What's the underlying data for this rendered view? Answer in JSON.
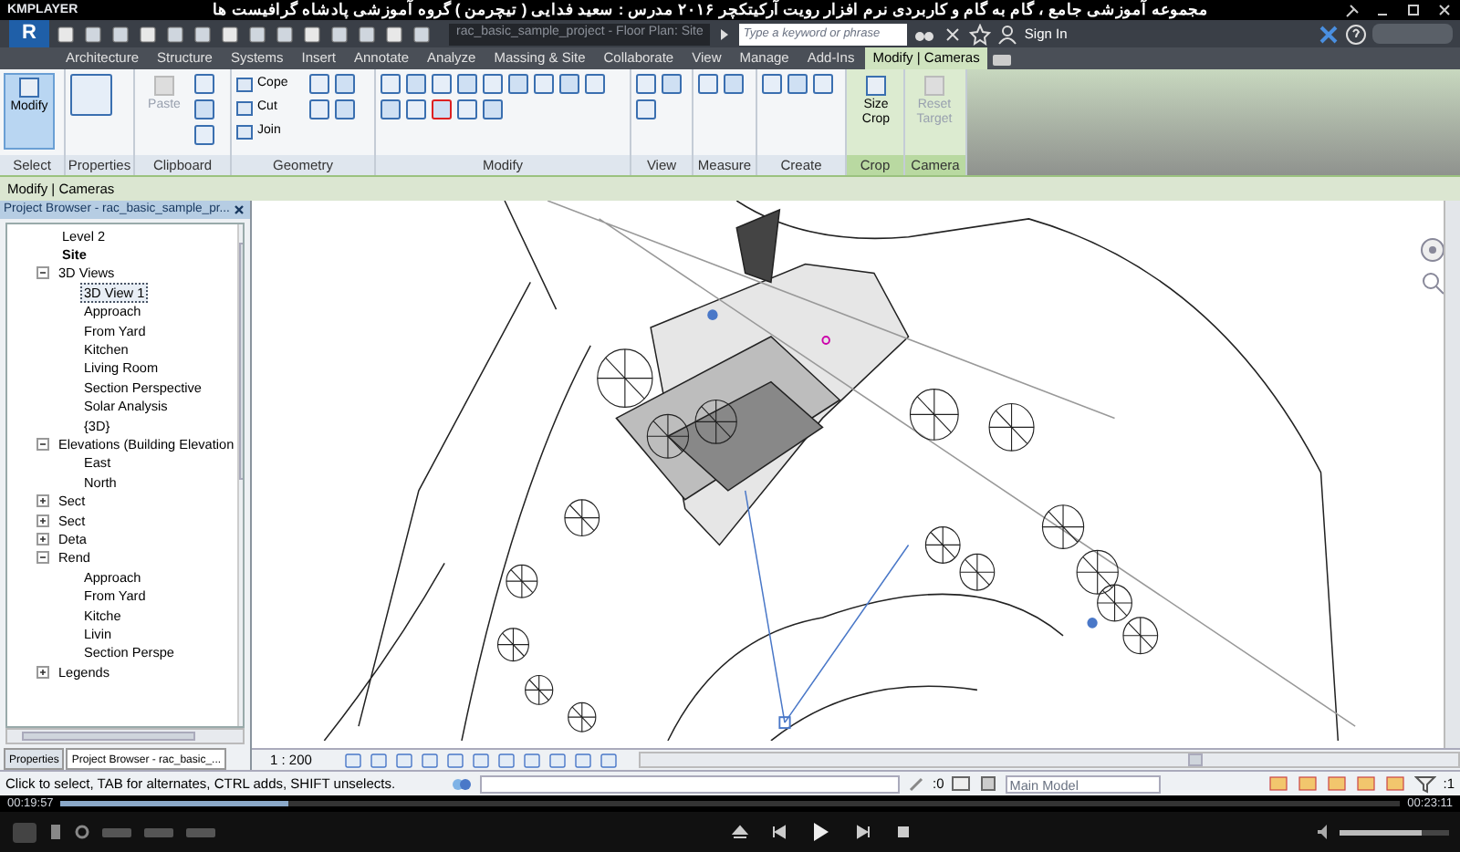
{
  "player": {
    "logo": "KMPLAYER",
    "title": "مجموعه آموزشی جامع ، گام به گام و کاربردی نرم افزار رویت آرکیتکچر ۲۰۱۶  مدرس : سعید فدایی ( تیچرمن ) گروه آموزشی پادشاه گرافیست ها",
    "elapsed": "00:19:57",
    "total": "00:23:11",
    "progress": {
      "level": 0.17
    },
    "volume": {
      "level": 0.75
    }
  },
  "app": {
    "logo": "R",
    "file_tab": "rac_basic_sample_project - Floor Plan: Site",
    "search": {
      "placeholder": "Type a keyword or phrase"
    },
    "sign_in": "Sign In"
  },
  "ribbon_tabs": [
    {
      "label": "Architecture",
      "selected": false
    },
    {
      "label": "Structure",
      "selected": false
    },
    {
      "label": "Systems",
      "selected": false
    },
    {
      "label": "Insert",
      "selected": false
    },
    {
      "label": "Annotate",
      "selected": false
    },
    {
      "label": "Analyze",
      "selected": false
    },
    {
      "label": "Massing & Site",
      "selected": false
    },
    {
      "label": "Collaborate",
      "selected": false
    },
    {
      "label": "View",
      "selected": false
    },
    {
      "label": "Manage",
      "selected": false
    },
    {
      "label": "Add-Ins",
      "selected": false
    },
    {
      "label": "Modify | Cameras",
      "selected": true
    }
  ],
  "panels": [
    {
      "label": "Select",
      "contextual": false,
      "tools": [
        {
          "label": "Modify",
          "selected": true,
          "disabled": false
        }
      ]
    },
    {
      "label": "Properties",
      "contextual": false
    },
    {
      "label": "Clipboard",
      "contextual": false,
      "tools": [
        {
          "label": "Paste",
          "selected": false,
          "disabled": true
        }
      ]
    },
    {
      "label": "Geometry",
      "contextual": false,
      "tools": [
        {
          "label": "Cope",
          "selected": false,
          "disabled": false
        },
        {
          "label": "Cut",
          "selected": false,
          "disabled": false
        },
        {
          "label": "Join",
          "selected": false,
          "disabled": false
        }
      ]
    },
    {
      "label": "Modify",
      "contextual": false
    },
    {
      "label": "View",
      "contextual": false
    },
    {
      "label": "Measure",
      "contextual": false
    },
    {
      "label": "Create",
      "contextual": false
    },
    {
      "label": "Crop",
      "contextual": true,
      "tools": [
        {
          "label": "Size Crop",
          "selected": false,
          "disabled": false
        }
      ]
    },
    {
      "label": "Camera",
      "contextual": true,
      "tools": [
        {
          "label": "Reset Target",
          "selected": false,
          "disabled": true
        }
      ]
    }
  ],
  "options_bar": "Modify | Cameras",
  "project_browser": {
    "title": "Project Browser - rac_basic_sample_pr...",
    "tree": [
      {
        "label": "Level 2",
        "current": false,
        "selected": false
      },
      {
        "label": "Site",
        "current": true,
        "selected": false
      },
      {
        "label": "3D Views",
        "expanded": true,
        "selected": false,
        "children": [
          {
            "label": "3D View 1",
            "current": false,
            "selected": true
          },
          {
            "label": "Approach",
            "current": false,
            "selected": false
          },
          {
            "label": "From Yard",
            "current": false,
            "selected": false
          },
          {
            "label": "Kitchen",
            "current": false,
            "selected": false
          },
          {
            "label": "Living Room",
            "current": false,
            "selected": false
          },
          {
            "label": "Section Perspective",
            "current": false,
            "selected": false
          },
          {
            "label": "Solar Analysis",
            "current": false,
            "selected": false
          },
          {
            "label": "{3D}",
            "current": false,
            "selected": false
          }
        ]
      },
      {
        "label": "Elevations (Building Elevation",
        "expanded": true,
        "selected": false,
        "children": [
          {
            "label": "East",
            "current": false,
            "selected": false
          },
          {
            "label": "North",
            "current": false,
            "selected": false
          }
        ]
      },
      {
        "label": "Sect",
        "expanded": false,
        "selected": false
      },
      {
        "label": "Sect",
        "expanded": false,
        "selected": false
      },
      {
        "label": "Deta",
        "expanded": false,
        "selected": false
      },
      {
        "label": "Rend",
        "expanded": true,
        "selected": false,
        "children": [
          {
            "label": "Approach",
            "current": false,
            "selected": false
          },
          {
            "label": "From Yard",
            "current": false,
            "selected": false
          },
          {
            "label": "Kitche",
            "current": false,
            "selected": false
          },
          {
            "label": "Livin",
            "current": false,
            "selected": false
          },
          {
            "label": "Section Perspe",
            "current": false,
            "selected": false
          }
        ]
      },
      {
        "label": "Legends",
        "expanded": false,
        "selected": false
      }
    ],
    "tabs": [
      {
        "label": "Properties",
        "selected": false
      },
      {
        "label": "Project Browser - rac_basic_...",
        "selected": true
      }
    ]
  },
  "view_control": {
    "scale": "1 : 200"
  },
  "status_bar": {
    "message": "Click to select, TAB for alternates, CTRL adds, SHIFT unselects.",
    "editable_count": ":0",
    "model": "Main Model",
    "filter_count": ":1"
  }
}
